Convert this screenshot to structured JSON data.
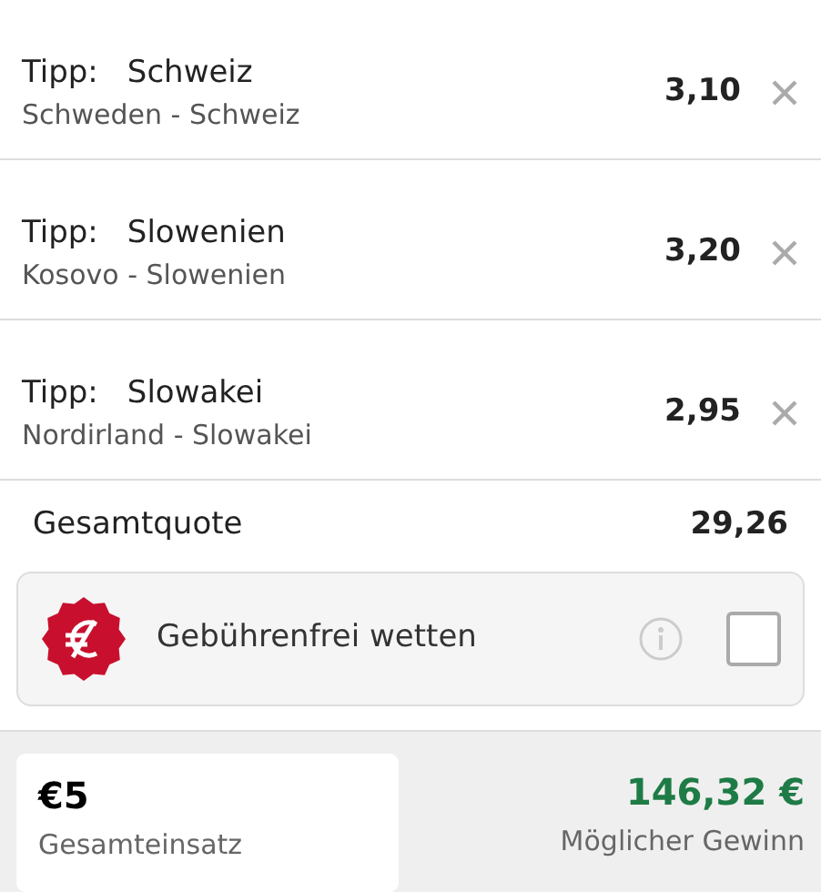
{
  "bets": [
    {
      "label": "Tipp:",
      "pick": "Schweiz",
      "match": "Schweden - Schweiz",
      "odds": "3,10"
    },
    {
      "label": "Tipp:",
      "pick": "Slowenien",
      "match": "Kosovo - Slowenien",
      "odds": "3,20"
    },
    {
      "label": "Tipp:",
      "pick": "Slowakei",
      "match": "Nordirland - Slowakei",
      "odds": "2,95"
    }
  ],
  "total": {
    "label": "Gesamtquote",
    "value": "29,26"
  },
  "fee_free": {
    "label": "Gebührenfrei wetten",
    "checked": false
  },
  "stake": {
    "value": "€5",
    "label": "Gesamteinsatz"
  },
  "winnings": {
    "value": "146,32 €",
    "label": "Möglicher Gewinn"
  }
}
